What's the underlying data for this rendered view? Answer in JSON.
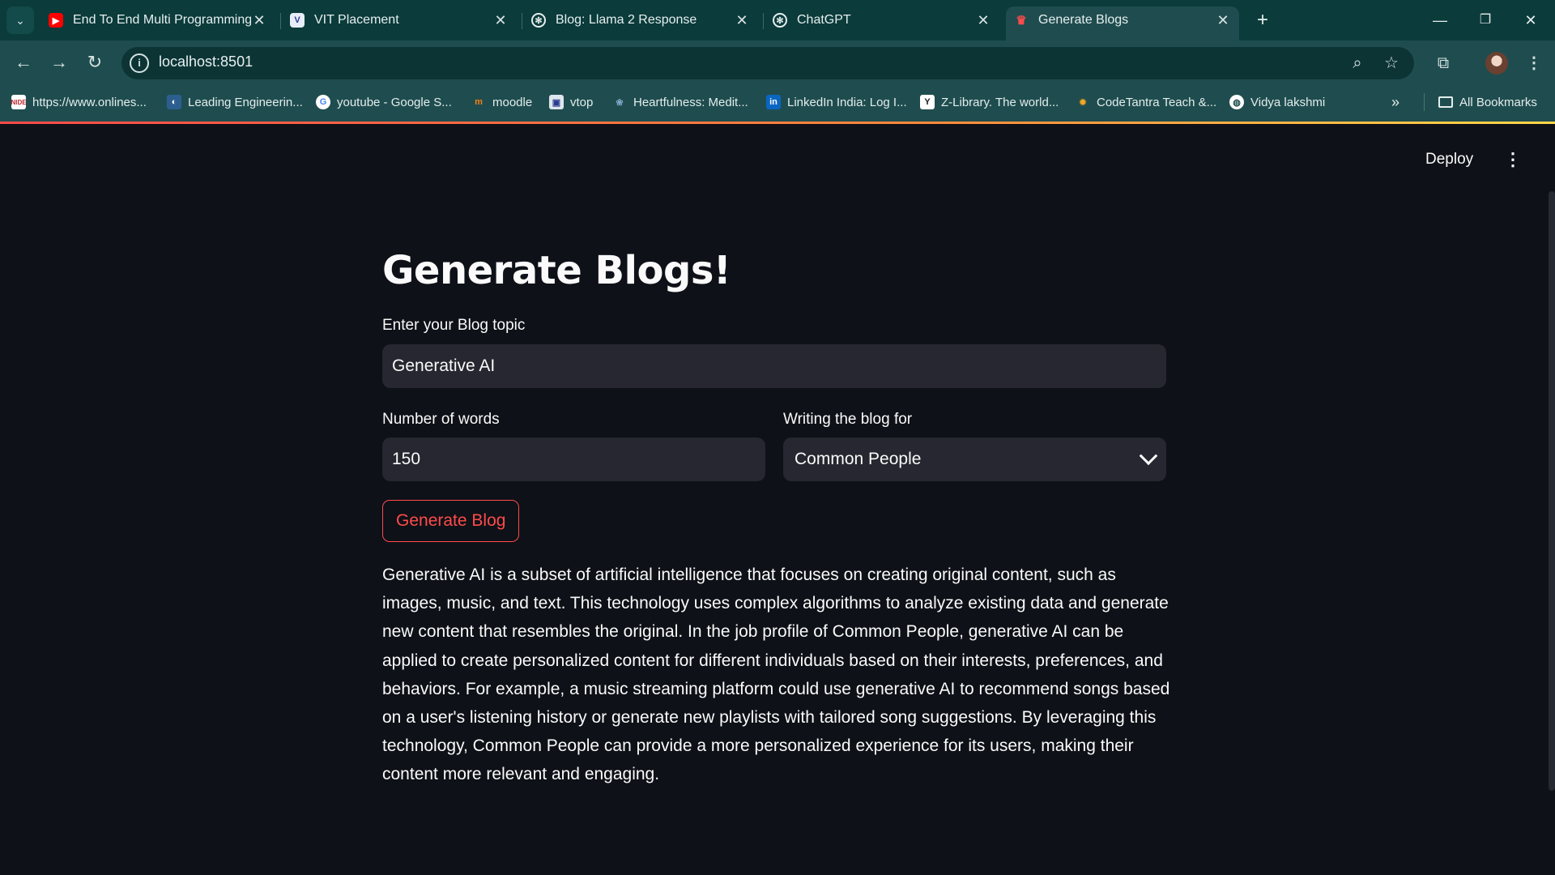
{
  "browser": {
    "tabs": [
      {
        "title": "End To End Multi Programming",
        "icon": "youtube-icon"
      },
      {
        "title": "VIT Placement",
        "icon": "vit-icon"
      },
      {
        "title": "Blog: Llama 2 Response",
        "icon": "chatgpt-icon"
      },
      {
        "title": "ChatGPT",
        "icon": "chatgpt-icon"
      },
      {
        "title": "Generate Blogs",
        "icon": "streamlit-icon",
        "active": true
      }
    ],
    "url": "localhost:8501",
    "bookmarks": [
      "https://www.onlines...",
      "Leading Engineerin...",
      "youtube - Google S...",
      "moodle",
      "vtop",
      "Heartfulness: Medit...",
      "LinkedIn India: Log I...",
      "Z-Library. The world...",
      "CodeTantra Teach &...",
      "Vidya lakshmi"
    ],
    "all_bookmarks": "All Bookmarks"
  },
  "app": {
    "deploy": "Deploy",
    "title": "Generate Blogs!",
    "topic_label": "Enter your Blog topic",
    "topic_value": "Generative AI",
    "words_label": "Number of words",
    "words_value": "150",
    "audience_label": "Writing the blog for",
    "audience_value": "Common People",
    "generate_button": "Generate Blog",
    "output": "Generative AI is a subset of artificial intelligence that focuses on creating original content, such as images, music, and text. This technology uses complex algorithms to analyze existing data and generate new content that resembles the original. In the job profile of Common People, generative AI can be applied to create personalized content for different individuals based on their interests, preferences, and behaviors. For example, a music streaming platform could use generative AI to recommend songs based on a user's listening history or generate new playlists with tailored song suggestions. By leveraging this technology, Common People can provide a more personalized experience for its users, making their content more relevant and engaging."
  },
  "colors": {
    "app_bg": "#0e1117",
    "input_bg": "#262730",
    "accent": "#ff4b4b",
    "chrome_bg": "#1f4d4f"
  }
}
